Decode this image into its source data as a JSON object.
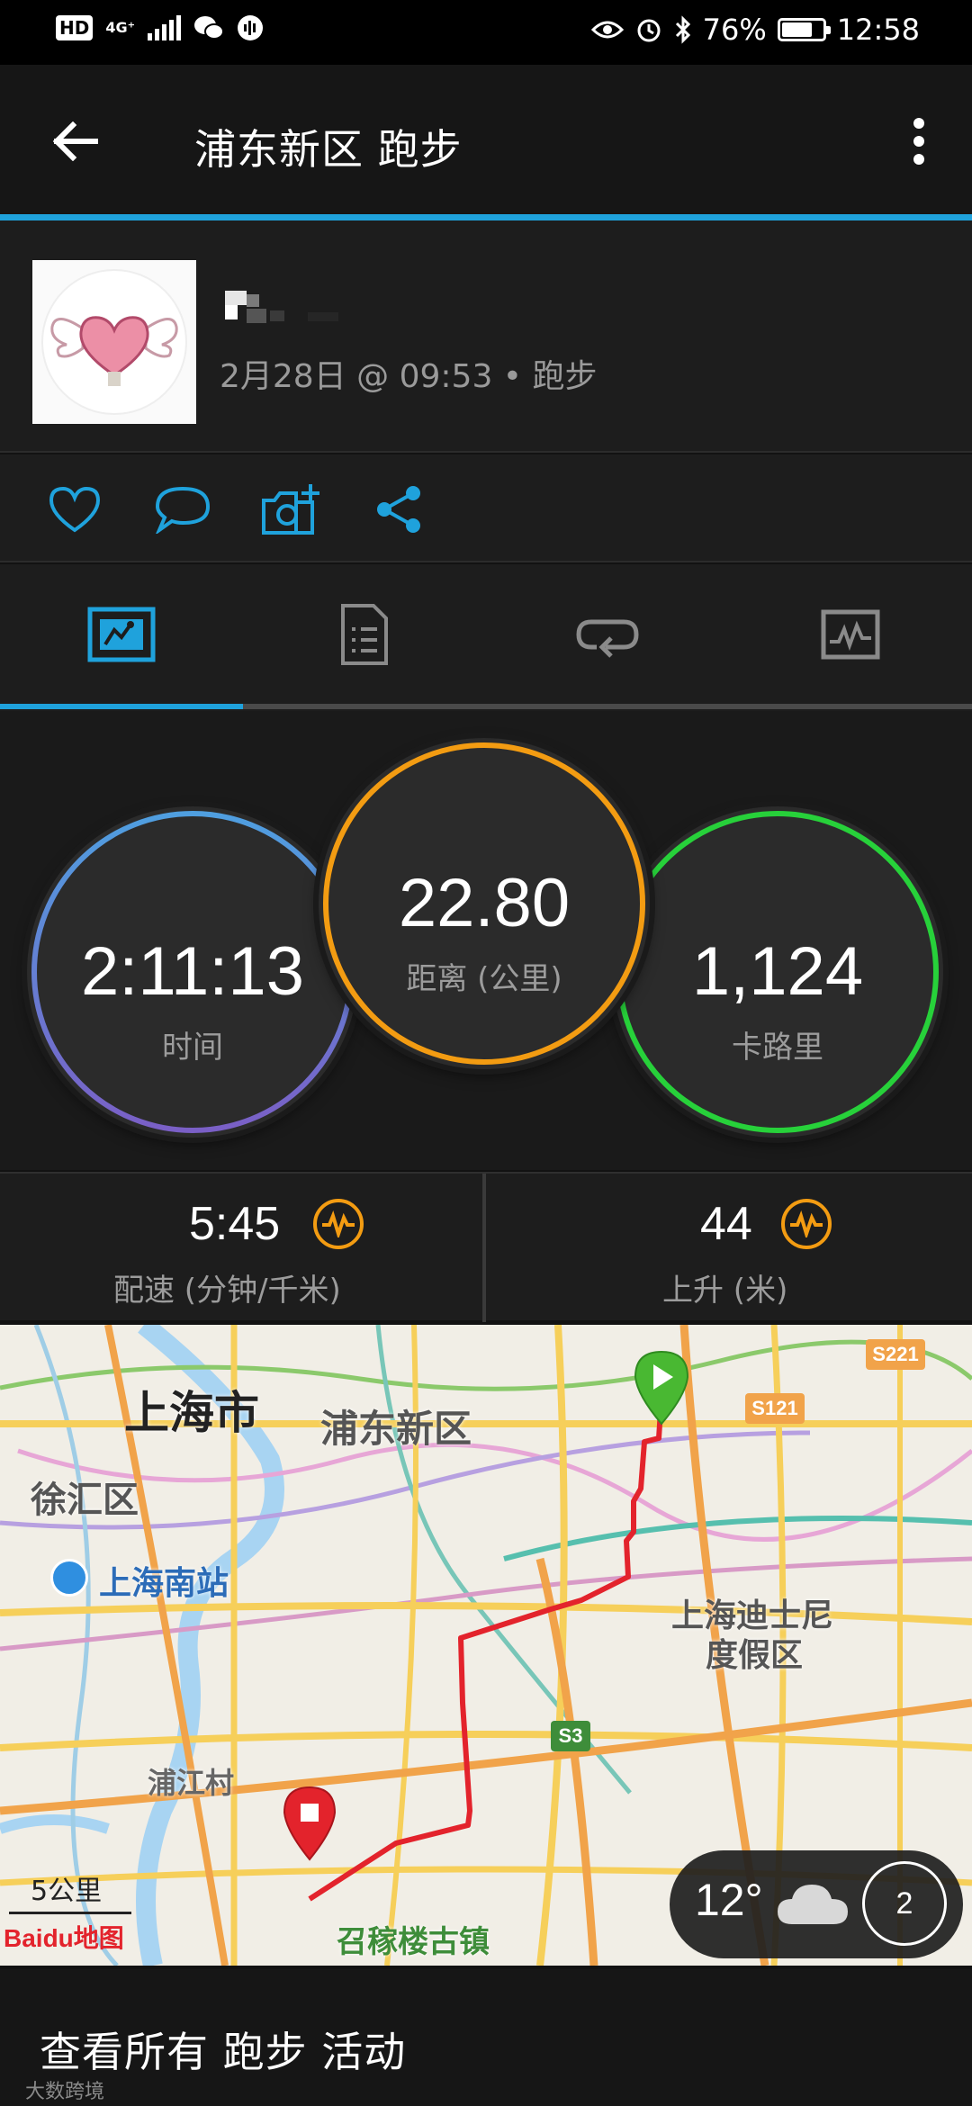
{
  "status_bar": {
    "network": "4G⁺",
    "battery": "76%",
    "battery_level": 0.76,
    "time": "12:58"
  },
  "header": {
    "title": "浦东新区 跑步",
    "back_icon": "arrow-left-icon",
    "more_icon": "more-vertical-icon"
  },
  "profile": {
    "meta": "2月28日 @ 09:53 • 跑步"
  },
  "actions": [
    {
      "icon": "heart-icon"
    },
    {
      "icon": "comment-icon"
    },
    {
      "icon": "add-photo-icon"
    },
    {
      "icon": "share-icon"
    }
  ],
  "tabs": [
    {
      "icon": "overview-icon",
      "active": true
    },
    {
      "icon": "details-icon",
      "active": false
    },
    {
      "icon": "laps-icon",
      "active": false
    },
    {
      "icon": "charts-icon",
      "active": false
    }
  ],
  "stats": {
    "time": {
      "value": "2:11:13",
      "label": "时间"
    },
    "distance": {
      "value": "22.80",
      "label": "距离 (公里)"
    },
    "calories": {
      "value": "1,124",
      "label": "卡路里"
    }
  },
  "sub_stats": {
    "pace": {
      "value": "5:45",
      "label": "配速 (分钟/千米)"
    },
    "ascent": {
      "value": "44",
      "label": "上升 (米)"
    }
  },
  "map": {
    "labels": {
      "city": "上海市",
      "pudong": "浦东新区",
      "xuhui": "徐汇区",
      "south_station": "上海南站",
      "disney_1": "上海迪士尼",
      "disney_2": "度假区",
      "pujiang": "浦江村",
      "zhaojialou": "召稼楼古镇",
      "s221": "S221",
      "s121": "S121",
      "s3": "S3"
    },
    "scale": "5公里",
    "weather": {
      "temp": "12°",
      "icon": "cloud-icon",
      "count": "2"
    },
    "brand": "Baidu地图"
  },
  "footer": {
    "link": "查看所有 跑步 活动",
    "watermark": "大数跨境"
  },
  "colors": {
    "accent": "#1fa2dc",
    "time_ring": "#5b86d6",
    "distance_ring": "#f39c12",
    "calories_ring": "#27d13a",
    "route": "#e3232c"
  }
}
